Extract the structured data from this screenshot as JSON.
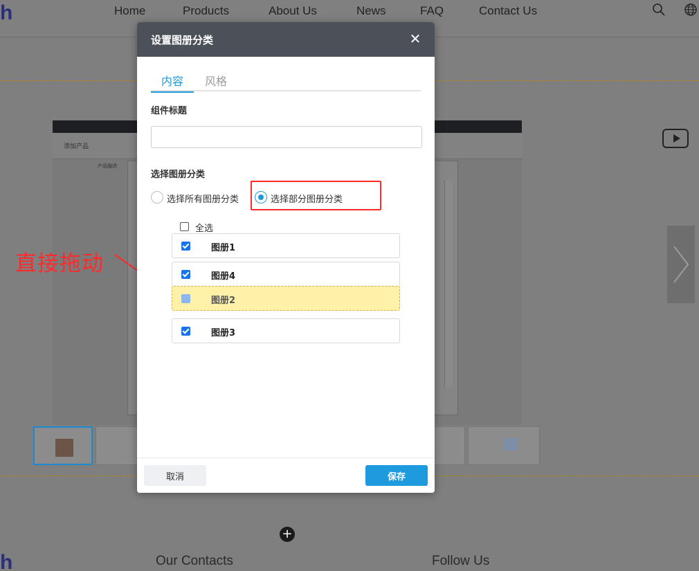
{
  "site": {
    "logo_fragment": "h",
    "nav": [
      "Home",
      "Products",
      "About Us",
      "News",
      "FAQ",
      "Contact Us"
    ],
    "gallery_strip_label": "添加产品",
    "gallery_panel_label": "产品描述",
    "footer": {
      "contacts_heading": "Our Contacts",
      "follow_heading": "Follow Us"
    }
  },
  "annotation": {
    "text": "直接拖动",
    "color": "#ff2a2a"
  },
  "modal": {
    "title": "设置图册分类",
    "tabs": [
      {
        "label": "内容",
        "active": true
      },
      {
        "label": "风格",
        "active": false
      }
    ],
    "component_title_label": "组件标题",
    "component_title_value": "",
    "category_section_label": "选择图册分类",
    "radio_options": [
      {
        "label": "选择所有图册分类",
        "checked": false
      },
      {
        "label": "选择部分图册分类",
        "checked": true
      }
    ],
    "select_all_label": "全选",
    "albums": [
      {
        "name": "图册1",
        "checked": true,
        "dragging": false
      },
      {
        "name": "图册4",
        "checked": true,
        "dragging": false
      },
      {
        "name": "图册2",
        "checked": true,
        "dragging": true
      },
      {
        "name": "图册3",
        "checked": true,
        "dragging": false
      }
    ],
    "cancel_label": "取消",
    "save_label": "保存",
    "accent_color": "#1e9bd7"
  }
}
